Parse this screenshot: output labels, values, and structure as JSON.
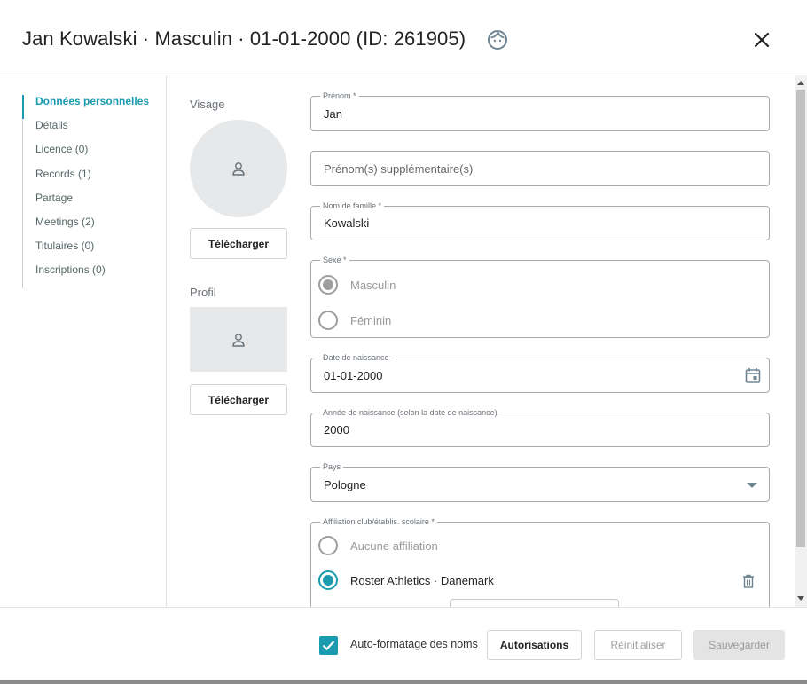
{
  "header": {
    "title": "Jan Kowalski · Masculin · 01-01-2000 (ID: 261905)",
    "face_icon": "face-icon",
    "close_icon": "close-icon"
  },
  "nav": {
    "items": [
      {
        "label": "Données personnelles",
        "active": true
      },
      {
        "label": "Détails"
      },
      {
        "label": "Licence (0)"
      },
      {
        "label": "Records (1)"
      },
      {
        "label": "Partage"
      },
      {
        "label": "Meetings (2)"
      },
      {
        "label": "Titulaires (0)"
      },
      {
        "label": "Inscriptions (0)"
      }
    ]
  },
  "images": {
    "face_label": "Visage",
    "profile_label": "Profil",
    "upload_label": "Télécharger",
    "placeholder_icon": "person-icon"
  },
  "form": {
    "first_name": {
      "legend": "Prénom *",
      "value": "Jan"
    },
    "extra_names": {
      "placeholder": "Prénom(s) supplémentaire(s)"
    },
    "last_name": {
      "legend": "Nom de famille *",
      "value": "Kowalski"
    },
    "sex": {
      "legend": "Sexe *",
      "options": [
        "Masculin",
        "Féminin"
      ],
      "selected": "Masculin"
    },
    "birth_date": {
      "legend": "Date de naissance",
      "value": "01-01-2000",
      "icon": "calendar-icon"
    },
    "birth_year": {
      "legend": "Année de naissance (selon la date de naissance)",
      "value": "2000"
    },
    "country": {
      "legend": "Pays",
      "value": "Pologne",
      "icon": "dropdown-arrow-icon"
    },
    "affiliation": {
      "legend": "Affiliation club/établis. scolaire *",
      "options": [
        "Aucune affiliation",
        "Roster Athletics · Danemark"
      ],
      "selected": "Roster Athletics · Danemark",
      "delete_icon": "trash-icon"
    }
  },
  "footer": {
    "autoformat_label": "Auto-formatage des noms",
    "autoformat_checked": true,
    "permissions_label": "Autorisations",
    "reset_label": "Réinitialiser",
    "save_label": "Sauvegarder"
  },
  "colors": {
    "accent": "#1a9bb0",
    "disabled_bg": "#e4e4e4"
  }
}
